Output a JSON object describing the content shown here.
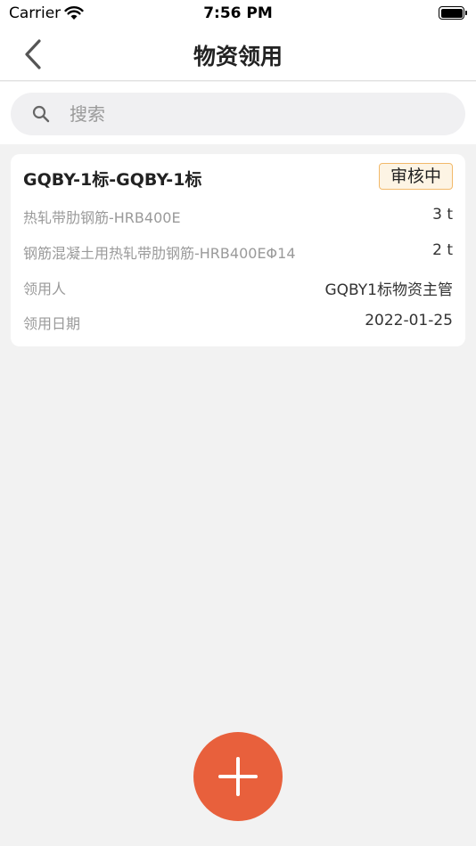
{
  "status_bar": {
    "carrier": "Carrier",
    "time": "7:56 PM"
  },
  "nav": {
    "title": "物资领用"
  },
  "search": {
    "placeholder": "搜索",
    "value": ""
  },
  "records": [
    {
      "title": "GQBY-1标-GQBY-1标",
      "status": "审核中",
      "items": [
        {
          "name": "热轧带肋钢筋-HRB400E",
          "quantity": "3 t"
        },
        {
          "name": "钢筋混凝土用热轧带肋钢筋-HRB400EΦ14",
          "quantity": "2 t"
        }
      ],
      "recipient_label": "领用人",
      "recipient": "GQBY1标物资主管",
      "date_label": "领用日期",
      "date": "2022-01-25"
    }
  ],
  "colors": {
    "accent": "#e8603c",
    "badge_border": "#f2b96a",
    "badge_bg": "#fdf4e4",
    "background": "#f2f2f2"
  },
  "icons": {
    "back": "chevron-left-icon",
    "search": "magnifier-icon",
    "add": "plus-icon"
  }
}
